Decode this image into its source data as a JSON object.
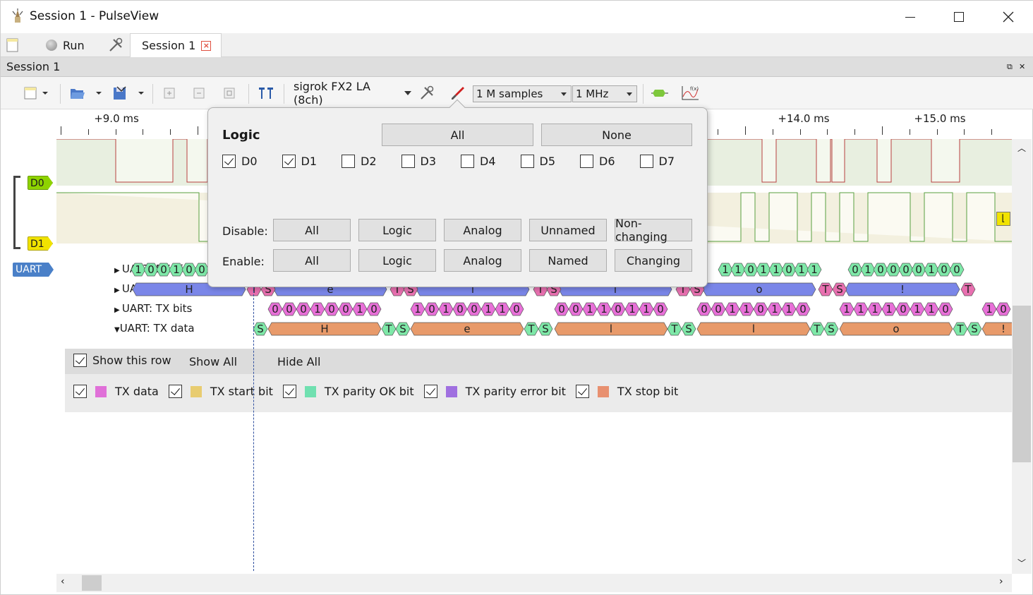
{
  "window": {
    "title": "Session 1 - PulseView"
  },
  "tabbar": {
    "run_label": "Run",
    "session_tab": "Session 1"
  },
  "dock": {
    "title": "Session 1"
  },
  "toolbar": {
    "device": "sigrok FX2 LA (8ch)",
    "samples": "1 M samples",
    "rate": "1 MHz"
  },
  "ruler": {
    "labels": [
      "+9.0 ms",
      "+14.0 ms",
      "+15.0 ms"
    ]
  },
  "channels": {
    "d0": "D0",
    "d1": "D1",
    "group": "UART"
  },
  "decoder_rows": [
    "UART: RX bits",
    "UART: RX data",
    "UART: TX bits",
    "UART: TX data"
  ],
  "popup": {
    "heading": "Logic",
    "all": "All",
    "none": "None",
    "channels": [
      {
        "label": "D0",
        "checked": true
      },
      {
        "label": "D1",
        "checked": true
      },
      {
        "label": "D2",
        "checked": false
      },
      {
        "label": "D3",
        "checked": false
      },
      {
        "label": "D4",
        "checked": false
      },
      {
        "label": "D5",
        "checked": false
      },
      {
        "label": "D6",
        "checked": false
      },
      {
        "label": "D7",
        "checked": false
      }
    ],
    "disable_label": "Disable:",
    "enable_label": "Enable:",
    "disable_buttons": [
      "All",
      "Logic",
      "Analog",
      "Unnamed",
      "Non-changing"
    ],
    "enable_buttons": [
      "All",
      "Logic",
      "Analog",
      "Named",
      "Changing"
    ]
  },
  "row_settings": {
    "show_this_row": "Show this row",
    "show_all": "Show All",
    "hide_all": "Hide All",
    "annotations": [
      {
        "label": "TX data",
        "color": "#e070d8"
      },
      {
        "label": "TX start bit",
        "color": "#e8cc70"
      },
      {
        "label": "TX parity OK bit",
        "color": "#70e0b0"
      },
      {
        "label": "TX parity error bit",
        "color": "#a070e0"
      },
      {
        "label": "TX stop bit",
        "color": "#e89070"
      }
    ]
  },
  "annotations": {
    "rx_bits": [
      "1",
      "0",
      "0",
      "1",
      "0",
      "0",
      "1",
      "1",
      "1",
      "0",
      "1",
      "1",
      "0",
      "1",
      "1",
      "0",
      "1",
      "0",
      "0",
      "0",
      "0",
      "1",
      "0",
      "0"
    ],
    "rx_data": [
      "H",
      "e",
      "l",
      "l",
      "o",
      "!"
    ],
    "tx_bits": [
      "0",
      "0",
      "0",
      "1",
      "0",
      "0",
      "1",
      "0",
      "1",
      "0",
      "1",
      "0",
      "0",
      "1",
      "1",
      "0",
      "0",
      "0",
      "1",
      "1",
      "0",
      "1",
      "1",
      "0",
      "0",
      "0",
      "1",
      "1",
      "0",
      "1",
      "1",
      "0",
      "1",
      "1",
      "1",
      "1",
      "0",
      "1",
      "1",
      "0",
      "1",
      "0"
    ],
    "tx_data": [
      "H",
      "e",
      "l",
      "l",
      "o",
      "!"
    ],
    "start": "S",
    "stop": "T"
  },
  "colors": {
    "green_channel": "#8ed300",
    "yellow_channel": "#f1e300",
    "tx_orange": "#e89a6a",
    "rx_blue": "#7a86e8",
    "bits_green": "#7ee8a8",
    "bits_pink": "#e870d8"
  }
}
